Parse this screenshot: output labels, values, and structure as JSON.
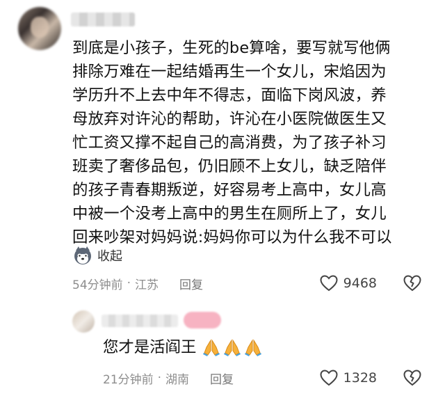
{
  "comment": {
    "lines": [
      "到底是小孩子，生死的be算啥，要写就写他俩",
      "排除万难在一起结婚再生一个女儿，宋焰因为",
      "学历升不上去中年不得志，面临下岗风波，养",
      "母放弃对许沁的帮助，许沁在小医院做医生又",
      "忙工资又撑不起自己的高消费，为了孩子补习",
      "班卖了奢侈品包，仍旧顾不上女儿，缺乏陪伴",
      "的孩子青春期叛逆，好容易考上高中，女儿高",
      "中被一个没考上高中的男生在厕所上了，女儿",
      "回来吵架对妈妈说:妈妈你可以为什么我不可以"
    ],
    "collapse_label": "收起",
    "time": "54分钟前",
    "separator": "·",
    "location": "江苏",
    "reply_label": "回复",
    "likes": "9468"
  },
  "reply": {
    "text": "您才是活阎王",
    "time": "21分钟前",
    "separator": "·",
    "location": "湖南",
    "reply_label": "回复",
    "likes": "1328"
  }
}
